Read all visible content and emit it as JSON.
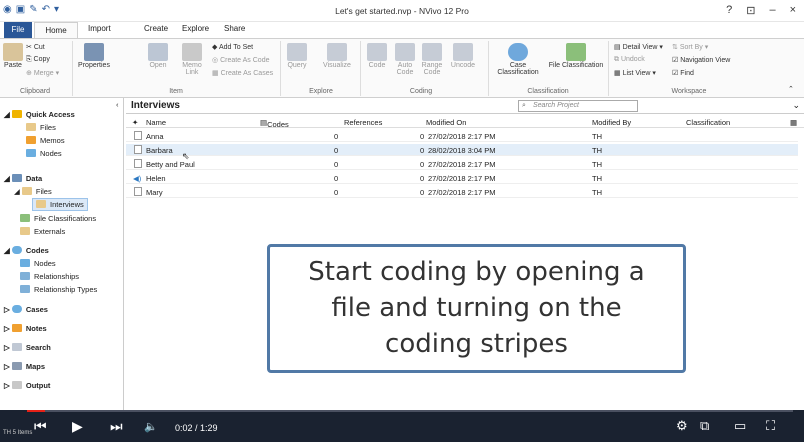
{
  "window": {
    "title": "Let's get started.nvp - NVivo 12 Pro",
    "help": "?",
    "restore": "⊡",
    "minimize": "–",
    "close": "×"
  },
  "ribbon_tabs": [
    "File",
    "Home",
    "Import",
    "Create",
    "Explore",
    "Share"
  ],
  "ribbon": {
    "clipboard": {
      "paste": "Paste",
      "cut": "Cut",
      "copy": "Copy",
      "merge": "Merge",
      "group": "Clipboard"
    },
    "item": {
      "properties": "Properties",
      "open": "Open",
      "memo_link": "Memo Link",
      "add_to_set": "Add To Set",
      "create_as_code": "Create As Code",
      "create_as_cases": "Create As Cases",
      "group": "Item"
    },
    "explore": {
      "query": "Query",
      "visualize": "Visualize",
      "group": "Explore"
    },
    "coding": {
      "code": "Code",
      "auto_code": "Auto Code",
      "range_code": "Range Code",
      "uncode": "Uncode",
      "group": "Coding"
    },
    "classification": {
      "case": "Case Classification",
      "file": "File Classification",
      "group": "Classification"
    },
    "workspace": {
      "detail_view": "Detail View",
      "sort_by": "Sort By",
      "undock": "Undock",
      "navigation_view": "Navigation View",
      "list_view": "List View",
      "find": "Find",
      "group": "Workspace"
    }
  },
  "nav": {
    "quick_access": "Quick Access",
    "files": "Files",
    "memos": "Memos",
    "nodes": "Nodes",
    "data": "Data",
    "data_files": "Files",
    "interviews": "Interviews",
    "file_classifications": "File Classifications",
    "externals": "Externals",
    "codes": "Codes",
    "codes_nodes": "Nodes",
    "relationships": "Relationships",
    "relationship_types": "Relationship Types",
    "cases": "Cases",
    "notes": "Notes",
    "search": "Search",
    "maps": "Maps",
    "output": "Output"
  },
  "list": {
    "title": "Interviews",
    "search_placeholder": "Search Project",
    "columns": [
      "Name",
      "Codes",
      "References",
      "Modified On",
      "Modified By",
      "Classification"
    ],
    "rows": [
      {
        "name": "Anna",
        "codes": "0",
        "references": "0",
        "modified_on": "27/02/2018 2:17 PM",
        "modified_by": "TH",
        "classification": ""
      },
      {
        "name": "Barbara",
        "codes": "0",
        "references": "0",
        "modified_on": "28/02/2018 3:04 PM",
        "modified_by": "TH",
        "classification": ""
      },
      {
        "name": "Betty and Paul",
        "codes": "0",
        "references": "0",
        "modified_on": "27/02/2018 2:17 PM",
        "modified_by": "TH",
        "classification": ""
      },
      {
        "name": "Helen",
        "codes": "0",
        "references": "0",
        "modified_on": "27/02/2018 2:17 PM",
        "modified_by": "TH",
        "classification": ""
      },
      {
        "name": "Mary",
        "codes": "0",
        "references": "0",
        "modified_on": "27/02/2018 2:17 PM",
        "modified_by": "TH",
        "classification": ""
      }
    ]
  },
  "overlay": {
    "line1": "Start coding by opening a",
    "line2": "file and turning on the",
    "line3": "coding stripes"
  },
  "player": {
    "time": "0:02 / 1:29",
    "progress_fraction": 0.023,
    "status": "TH   5 Items"
  },
  "colors": {
    "file_tab": "#2b5797",
    "overlay_border": "#5179a6",
    "progress": "#e62117",
    "player_bg": "#1a2230"
  }
}
